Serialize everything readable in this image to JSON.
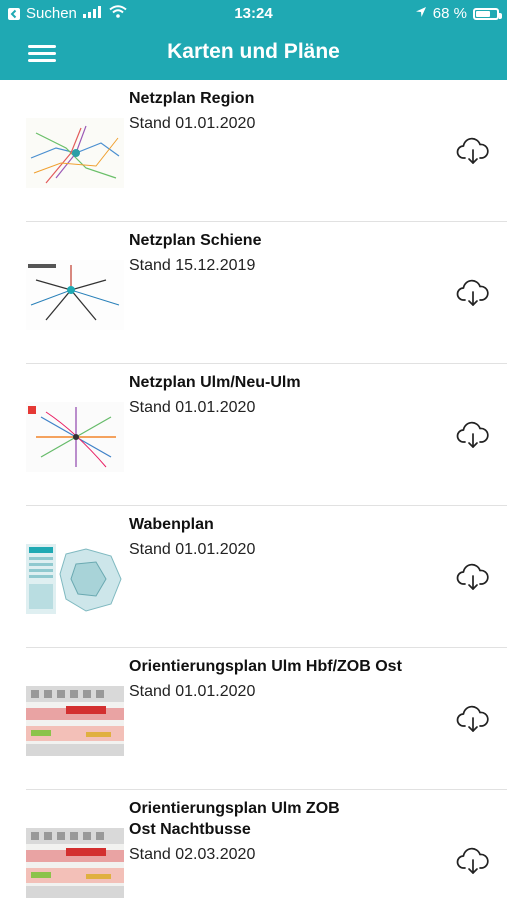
{
  "status_bar": {
    "back_app": "Suchen",
    "time": "13:24",
    "battery_percent": "68 %",
    "battery_level": 0.68
  },
  "header": {
    "title": "Karten und Pläne"
  },
  "items": [
    {
      "title": "Netzplan Region",
      "date": "Stand 01.01.2020",
      "thumb": "network-map"
    },
    {
      "title": "Netzplan Schiene",
      "date": "Stand 15.12.2019",
      "thumb": "rail-map"
    },
    {
      "title": "Netzplan Ulm/Neu-Ulm",
      "date": "Stand 01.01.2020",
      "thumb": "city-map"
    },
    {
      "title": "Wabenplan",
      "date": "Stand 01.01.2020",
      "thumb": "zone-map"
    },
    {
      "title": "Orientierungsplan Ulm Hbf/ZOB Ost",
      "date": "Stand 01.01.2020",
      "thumb": "orientation-map"
    },
    {
      "title": "Orientierungsplan Ulm ZOB Ost Nachtbusse",
      "date": "Stand 02.03.2020",
      "thumb": "orientation-map"
    }
  ],
  "icons": {
    "download": "cloud-download-icon",
    "menu": "hamburger-menu-icon"
  },
  "colors": {
    "header": "#1fa9b3",
    "separator": "#e1e1e1"
  }
}
